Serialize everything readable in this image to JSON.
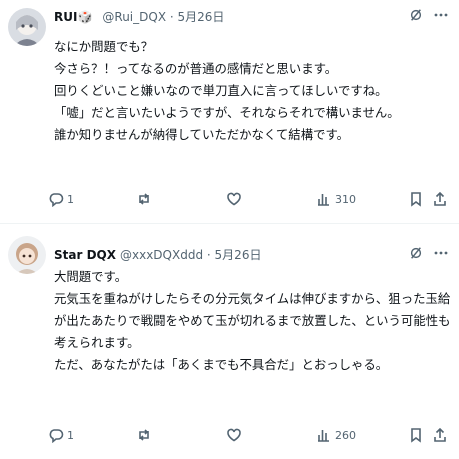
{
  "posts": [
    {
      "name": "RUI🎲",
      "handle": "@Rui_DQX",
      "dot": "·",
      "date": "5月26日",
      "text": "なにか問題でも？\n今さら？！ってなるのが普通の感情だと思います。\n回りくどいこと嫌いなので単刀直入に言ってほしいですね。\n「嘘」だと言いたいようですが、それならそれで構いません。\n誰か知りませんが納得していただかなくて結構です。",
      "reply_count": "1",
      "retweet_count": "",
      "like_count": "",
      "view_count": "310"
    },
    {
      "name": "Star DQX",
      "handle": "@xxxDQXddd",
      "dot": "·",
      "date": "5月26日",
      "text": "大問題です。\n元気玉を重ねがけしたらその分元気タイムは伸びますから、狙った玉給が出たあたりで戦闘をやめて玉が切れるまで放置した、という可能性も考えられます。\nただ、あなたがたは「あくまでも不具合だ」とおっしゃる。",
      "reply_count": "1",
      "retweet_count": "",
      "like_count": "",
      "view_count": "260"
    }
  ],
  "icons": {
    "grok": "slashed-circle-icon",
    "more": "more-dots-icon",
    "reply": "reply-bubble-icon",
    "retweet": "retweet-icon",
    "like": "heart-icon",
    "views": "views-chart-icon",
    "bookmark": "bookmark-icon",
    "share": "share-icon"
  },
  "colors": {
    "text": "#0f1419",
    "muted": "#536471",
    "divider": "#eff3f4"
  }
}
